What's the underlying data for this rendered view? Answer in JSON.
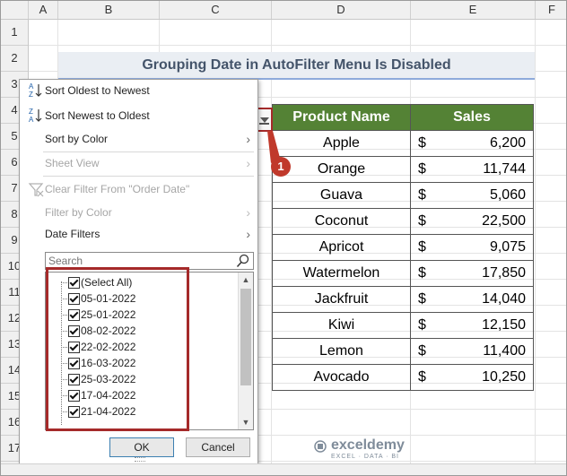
{
  "columns": [
    "A",
    "B",
    "C",
    "D",
    "E",
    "F"
  ],
  "rows": [
    "1",
    "2",
    "3",
    "4",
    "5",
    "6",
    "7",
    "8",
    "9",
    "10",
    "11",
    "12",
    "13",
    "14",
    "15",
    "16",
    "17"
  ],
  "sheet_title": "Grouping Date in AutoFilter Menu Is Disabled",
  "table": {
    "headers": {
      "product": "Product Name",
      "sales": "Sales"
    },
    "currency": "$",
    "rows": [
      {
        "product": "Apple",
        "sales": "6,200"
      },
      {
        "product": "Orange",
        "sales": "11,744"
      },
      {
        "product": "Guava",
        "sales": "5,060"
      },
      {
        "product": "Coconut",
        "sales": "22,500"
      },
      {
        "product": "Apricot",
        "sales": "9,075"
      },
      {
        "product": "Watermelon",
        "sales": "17,850"
      },
      {
        "product": "Jackfruit",
        "sales": "14,040"
      },
      {
        "product": "Kiwi",
        "sales": "12,150"
      },
      {
        "product": "Lemon",
        "sales": "11,400"
      },
      {
        "product": "Avocado",
        "sales": "10,250"
      }
    ]
  },
  "badge_number": "1",
  "menu": {
    "items": [
      {
        "label": "Sort Oldest to Newest",
        "enabled": true,
        "submenu": false
      },
      {
        "label": "Sort Newest to Oldest",
        "enabled": true,
        "submenu": false
      },
      {
        "label": "Sort by Color",
        "enabled": true,
        "submenu": true
      },
      {
        "label": "Sheet View",
        "enabled": false,
        "submenu": true
      },
      {
        "label": "Clear Filter From \"Order Date\"",
        "enabled": false,
        "submenu": false
      },
      {
        "label": "Filter by Color",
        "enabled": false,
        "submenu": true
      },
      {
        "label": "Date Filters",
        "enabled": true,
        "submenu": true
      }
    ],
    "search_placeholder": "Search",
    "list": [
      {
        "label": "(Select All)",
        "checked": true
      },
      {
        "label": "05-01-2022",
        "checked": true
      },
      {
        "label": "25-01-2022",
        "checked": true
      },
      {
        "label": "08-02-2022",
        "checked": true
      },
      {
        "label": "22-02-2022",
        "checked": true
      },
      {
        "label": "16-03-2022",
        "checked": true
      },
      {
        "label": "25-03-2022",
        "checked": true
      },
      {
        "label": "17-04-2022",
        "checked": true
      },
      {
        "label": "21-04-2022",
        "checked": true
      }
    ],
    "ok_label": "OK",
    "cancel_label": "Cancel"
  },
  "watermark": {
    "name": "exceldemy",
    "tagline": "EXCEL · DATA · BI"
  },
  "colors": {
    "header_green": "#548235",
    "highlight_red": "#a52a2a",
    "badge_red": "#c0392b",
    "title_text": "#44546a"
  }
}
